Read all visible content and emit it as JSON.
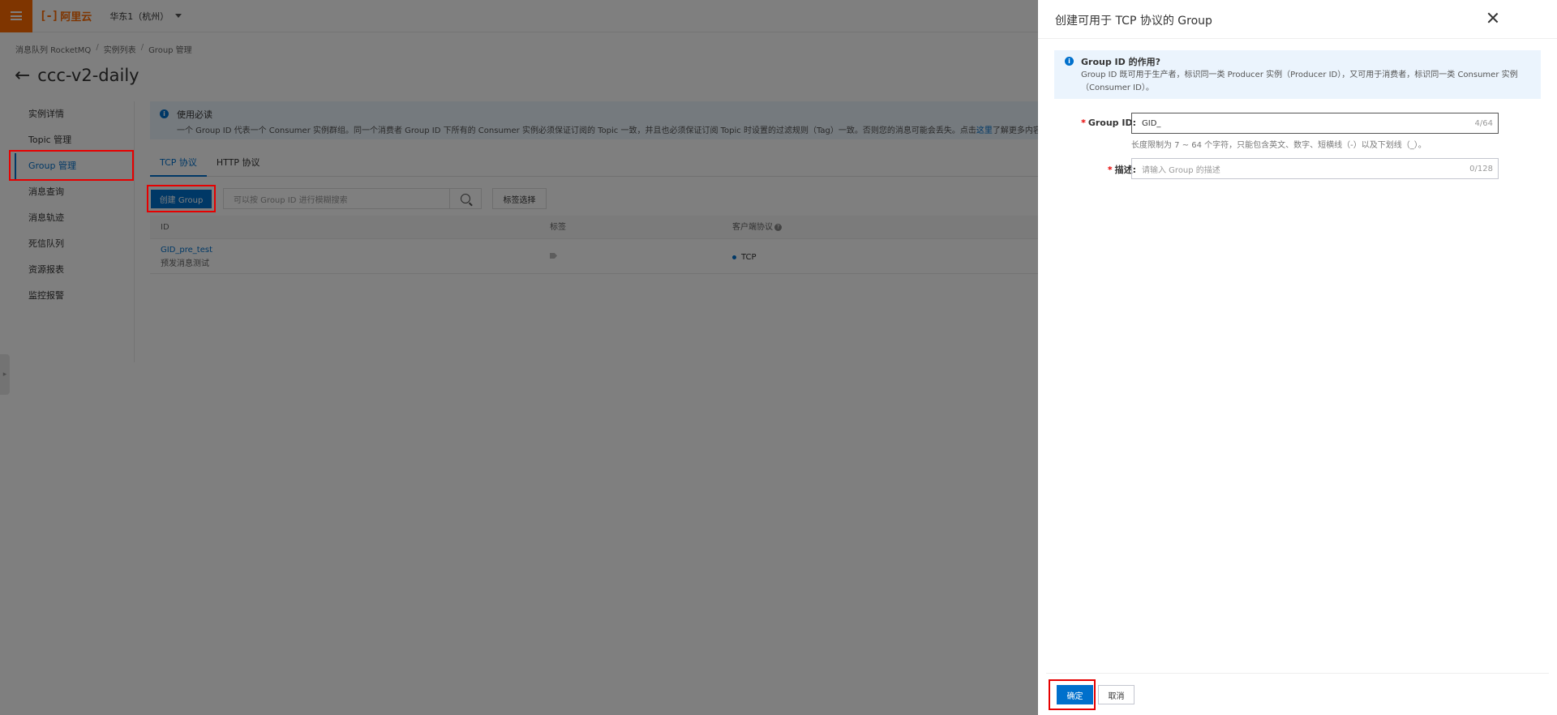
{
  "topbar": {
    "logo_text": "阿里云",
    "logo_mark": "[-]",
    "region": "华东1（杭州）"
  },
  "breadcrumb": [
    "消息队列 RocketMQ",
    "实例列表",
    "Group 管理"
  ],
  "page": {
    "title": "ccc-v2-daily"
  },
  "sidebar": {
    "items": [
      {
        "label": "实例详情"
      },
      {
        "label": "Topic 管理"
      },
      {
        "label": "Group 管理"
      },
      {
        "label": "消息查询"
      },
      {
        "label": "消息轨迹"
      },
      {
        "label": "死信队列"
      },
      {
        "label": "资源报表"
      },
      {
        "label": "监控报警"
      }
    ],
    "active_index": 2
  },
  "notice": {
    "title": "使用必读",
    "text": "一个 Group ID 代表一个 Consumer 实例群组。同一个消费者 Group ID 下所有的 Consumer 实例必须保证订阅的 Topic 一致，并且也必须保证订阅 Topic 时设置的过滤规则（Tag）一致。否则您的消息可能会丢失。点击",
    "link": "这里",
    "suffix": "了解更多内容。"
  },
  "tabs": [
    {
      "label": "TCP 协议"
    },
    {
      "label": "HTTP 协议"
    }
  ],
  "toolbar": {
    "create_label": "创建 Group",
    "search_placeholder": "可以按 Group ID 进行模糊搜索",
    "tag_select_label": "标签选择"
  },
  "table": {
    "columns": [
      "ID",
      "标签",
      "客户端协议"
    ],
    "rows": [
      {
        "id": "GID_pre_test",
        "desc": "预发消息测试",
        "protocol": "TCP"
      }
    ]
  },
  "drawer": {
    "title": "创建可用于 TCP 协议的 Group",
    "info_title": "Group ID 的作用?",
    "info_body": "Group ID 既可用于生产者，标识同一类 Producer 实例（Producer ID），又可用于消费者，标识同一类 Consumer 实例（Consumer ID）。",
    "group_id_label": "Group ID:",
    "group_id_value": "GID_",
    "group_id_counter": "4/64",
    "group_id_hint": "长度限制为 7 ~ 64 个字符，只能包含英文、数字、短横线（-）以及下划线（_）。",
    "desc_label": "描述:",
    "desc_placeholder": "请输入 Group 的描述",
    "desc_counter": "0/128",
    "ok_label": "确定",
    "cancel_label": "取消"
  },
  "colors": {
    "brand": "#ff6a00",
    "primary": "#0070cc",
    "highlight": "#e60000"
  }
}
